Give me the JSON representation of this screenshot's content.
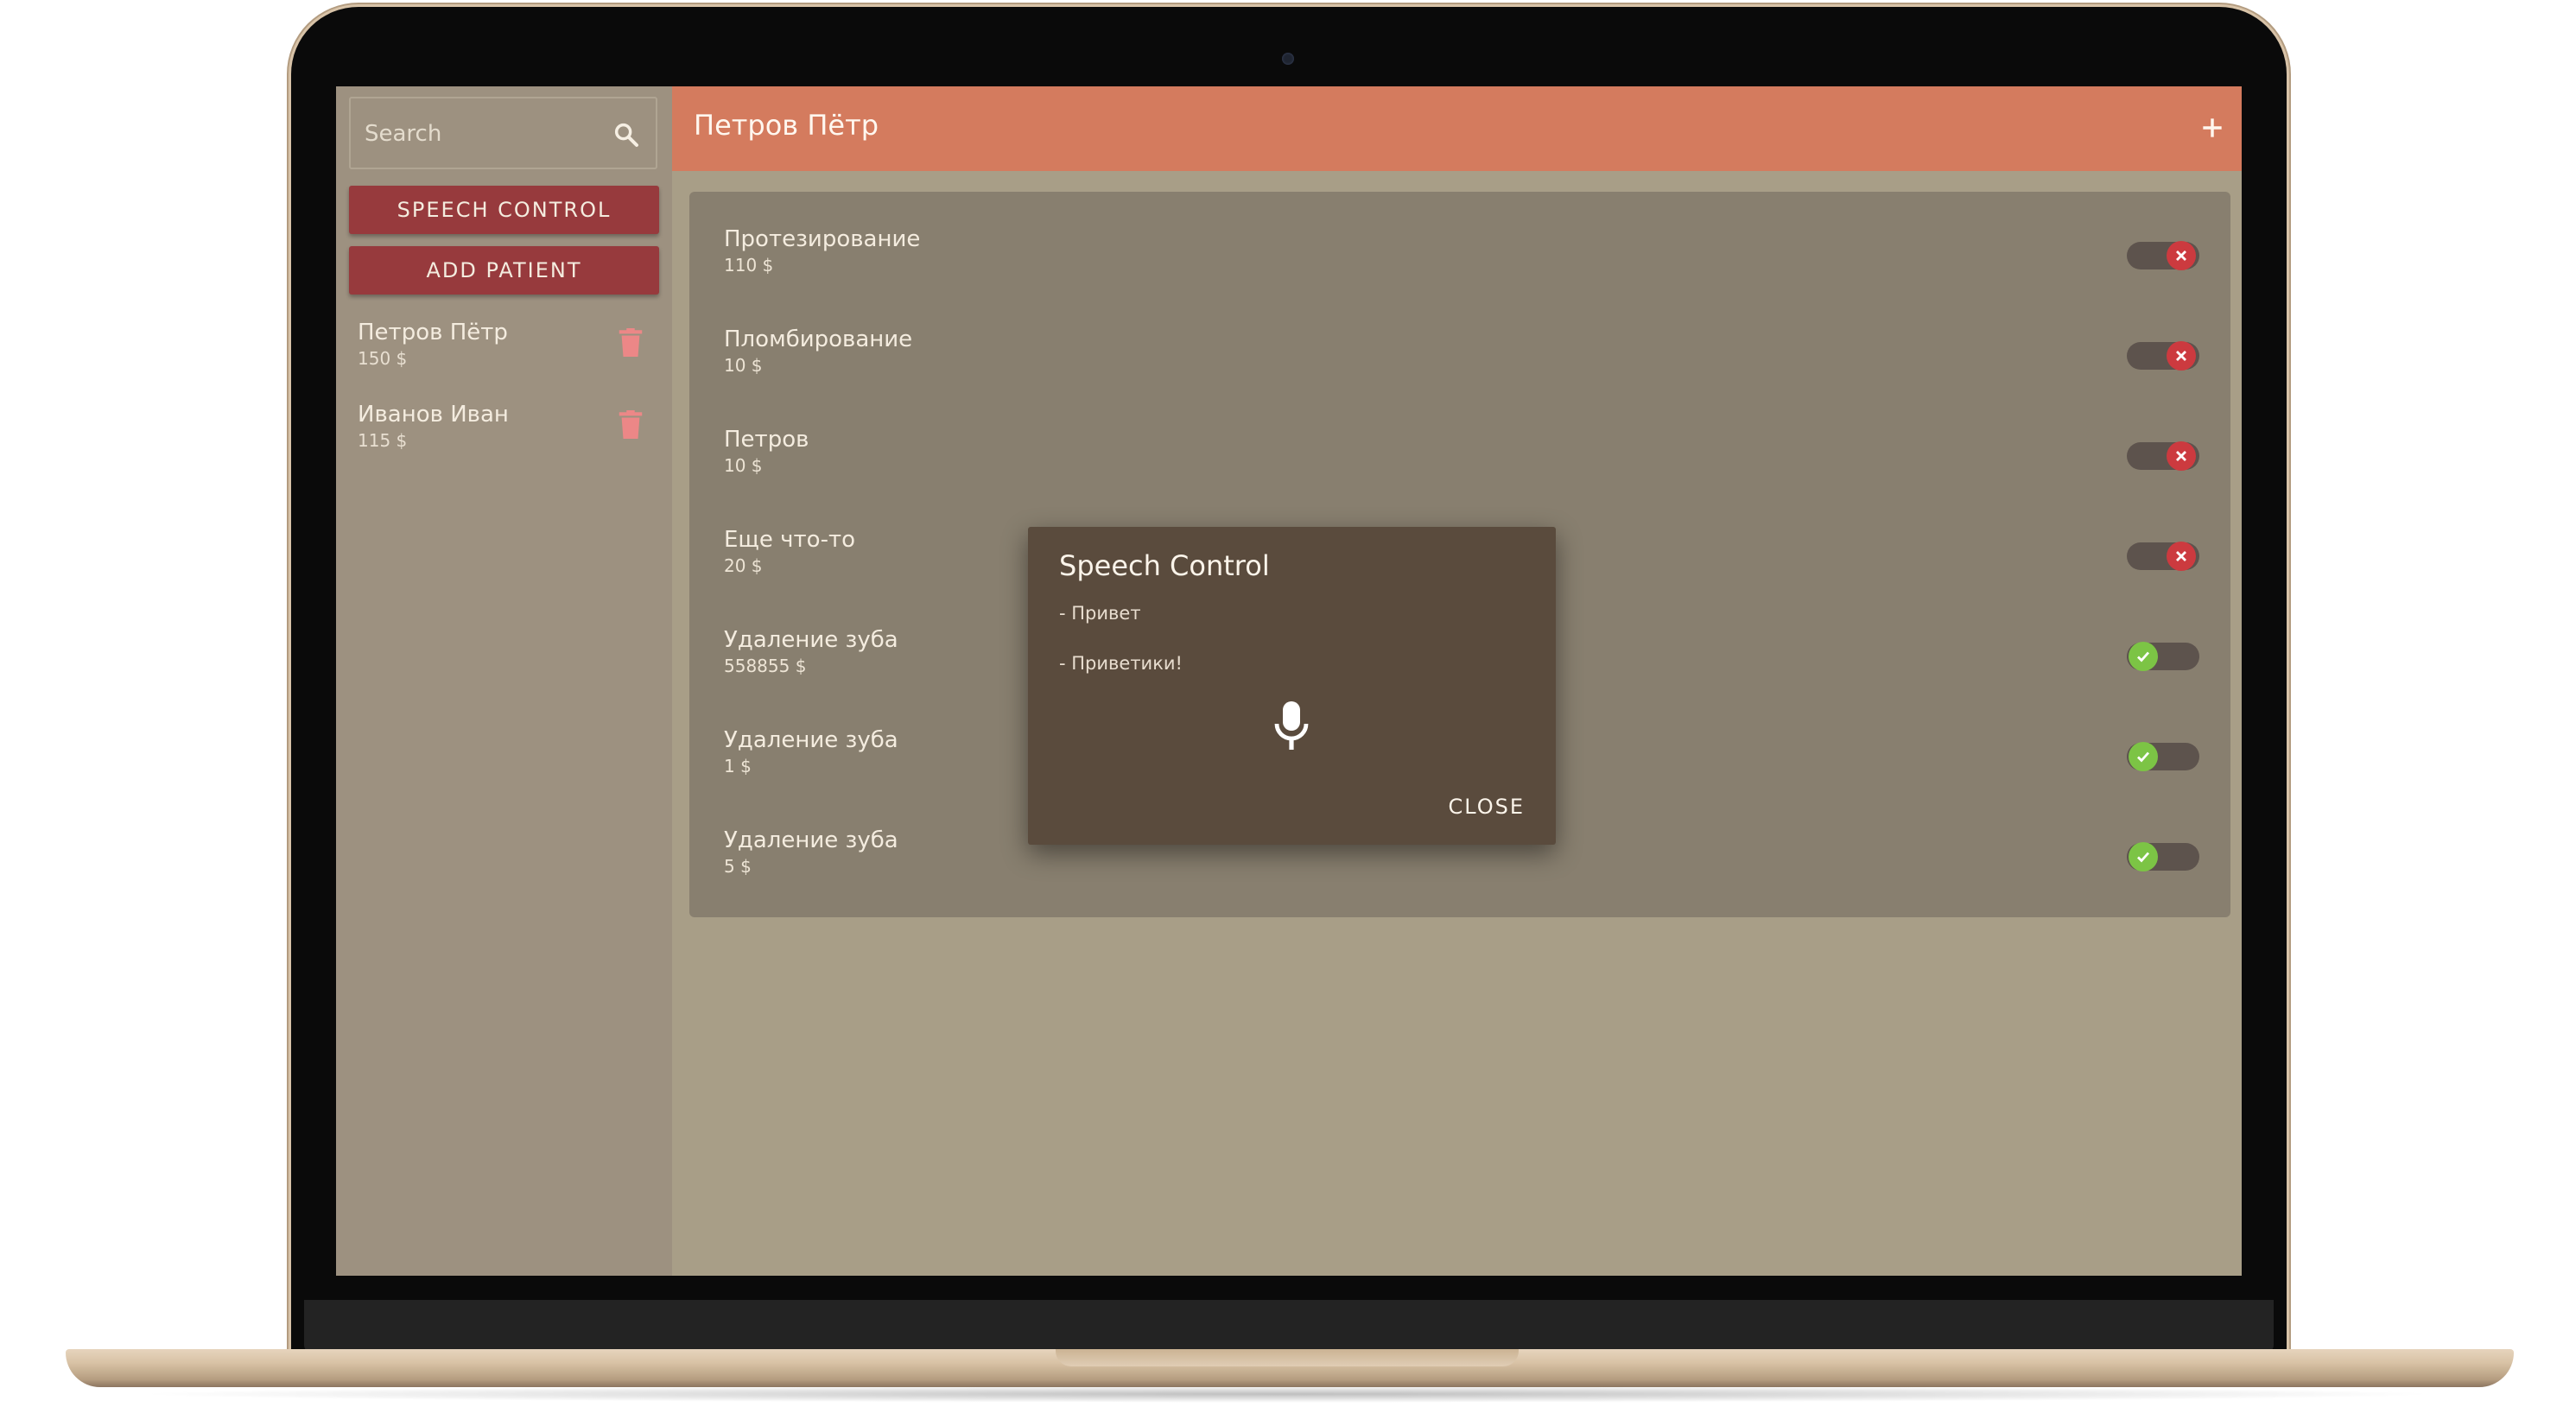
{
  "search": {
    "placeholder": "Search"
  },
  "sidebar": {
    "speech_button": "SPEECH CONTROL",
    "add_button": "ADD PATIENT",
    "patients": [
      {
        "name": "Петров Пётр",
        "amount": "150 $"
      },
      {
        "name": "Иванов Иван",
        "amount": "115 $"
      }
    ]
  },
  "header": {
    "title": "Петров Пётр"
  },
  "services": [
    {
      "name": "Протезирование",
      "price": "110 $",
      "done": false
    },
    {
      "name": "Пломбирование",
      "price": "10 $",
      "done": false
    },
    {
      "name": "Петров",
      "price": "10 $",
      "done": false
    },
    {
      "name": "Еще что-то",
      "price": "20 $",
      "done": false
    },
    {
      "name": "Удаление зуба",
      "price": "558855 $",
      "done": true
    },
    {
      "name": "Удаление зуба",
      "price": "1 $",
      "done": true
    },
    {
      "name": "Удаление зуба",
      "price": "5 $",
      "done": true
    }
  ],
  "dialog": {
    "title": "Speech Control",
    "lines": [
      "- Привет",
      "- Приветики!"
    ],
    "close_label": "CLOSE"
  },
  "colors": {
    "header": "#d47b5e",
    "button": "#973a3d",
    "toggle_off": "#cc3a3f",
    "toggle_on": "#7cc445",
    "dialog_bg": "#5a4b3d"
  },
  "icons": {
    "search": "search-icon",
    "add": "plus-icon",
    "delete": "trash-icon",
    "microphone": "microphone-icon",
    "toggle_off": "close-icon",
    "toggle_on": "check-icon"
  }
}
